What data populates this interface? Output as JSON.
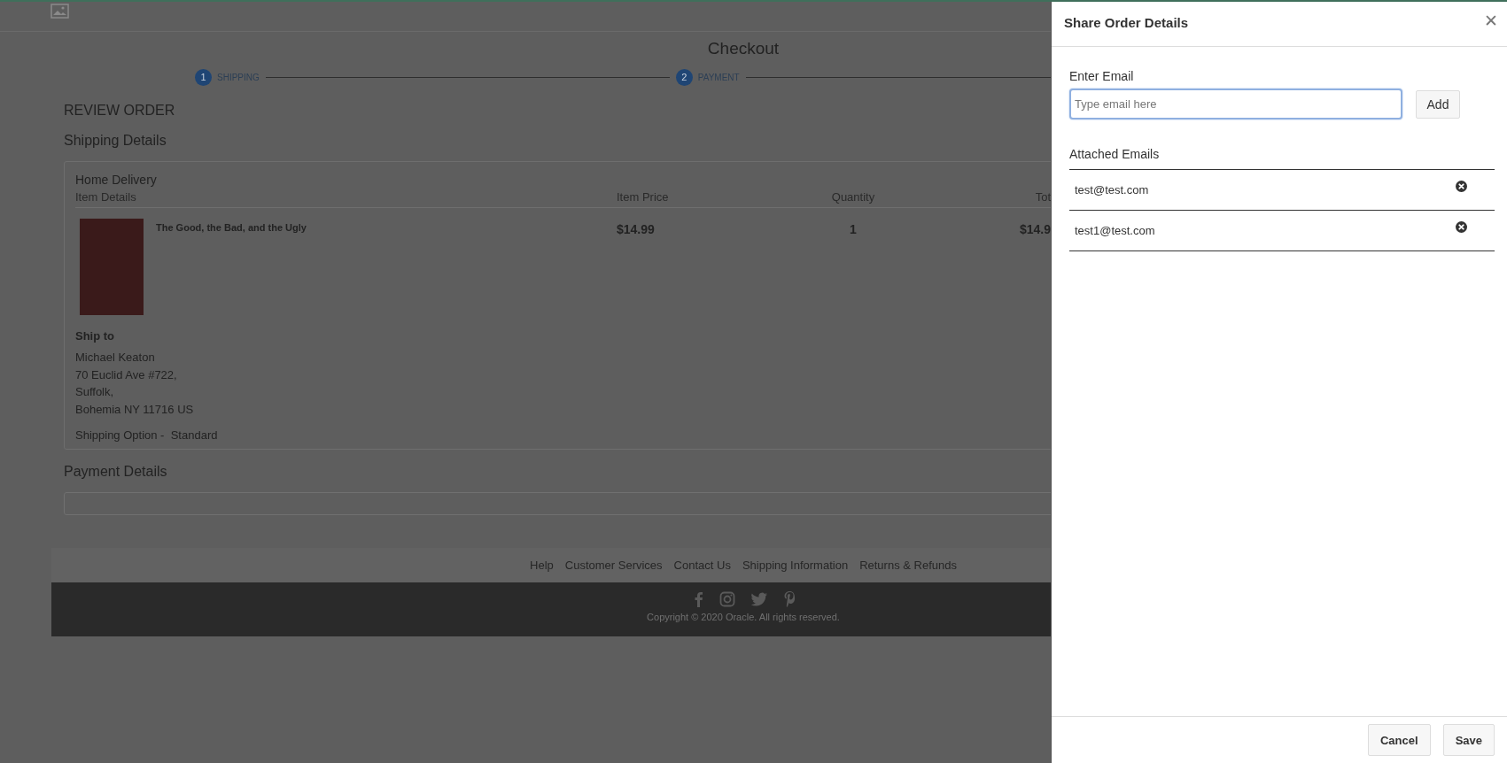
{
  "page": {
    "title": "Checkout",
    "steps": [
      {
        "number": "1",
        "label": "SHIPPING"
      },
      {
        "number": "2",
        "label": "PAYMENT"
      }
    ],
    "section_title": "REVIEW ORDER",
    "shipping": {
      "heading": "Shipping Details",
      "card_title": "Home Delivery",
      "columns": [
        "Item Details",
        "Item Price",
        "Quantity",
        "Tot"
      ],
      "items": [
        {
          "name": "The Good, the Bad, and the Ugly",
          "price": "$14.99",
          "quantity": "1",
          "total": "$14.9"
        }
      ],
      "ship_to_label": "Ship to",
      "address": [
        "Michael Keaton",
        "70 Euclid Ave #722,",
        "Suffolk,",
        "Bohemia NY 11716 US"
      ],
      "shipping_option": "Shipping Option -  Standard"
    },
    "payment": {
      "heading": "Payment Details"
    }
  },
  "footer": {
    "links": [
      "Help",
      "Customer Services",
      "Contact Us",
      "Shipping Information",
      "Returns & Refunds"
    ],
    "copyright": "Copyright © 2020 Oracle. All rights reserved."
  },
  "dialog": {
    "title": "Share Order Details",
    "close": "✕",
    "email_label": "Enter Email",
    "email_field": {
      "placeholder": "Type email here"
    },
    "add_button": "Add",
    "attached_label": "Attached Emails",
    "emails": [
      "test@test.com",
      "test1@test.com"
    ],
    "buttons": [
      "Cancel",
      "Save"
    ]
  }
}
